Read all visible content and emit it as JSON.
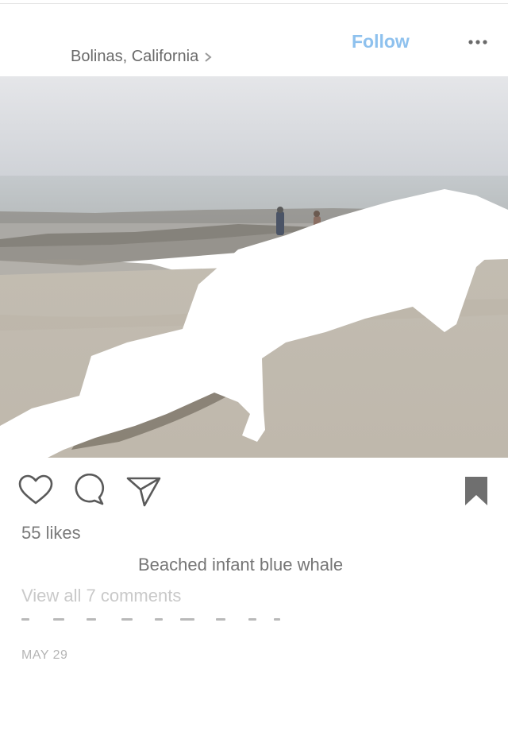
{
  "post": {
    "location": "Bolinas, California",
    "follow_label": "Follow",
    "likes": "55 likes",
    "caption": "Beached infant blue whale",
    "view_comments": "View all 7 comments",
    "date": "MAY 29"
  },
  "icons": {
    "location_chevron": "chevron-right-icon",
    "more": "more-dots-icon",
    "like": "heart-icon",
    "comment": "comment-bubble-icon",
    "share": "send-paper-plane-icon",
    "save": "bookmark-icon"
  },
  "colors": {
    "follow": "#8ec1ee",
    "text": "#6a6a6a",
    "muted": "#c9c9c9",
    "icon": "#5a5a5a",
    "bookmark": "#6f6f6f"
  }
}
